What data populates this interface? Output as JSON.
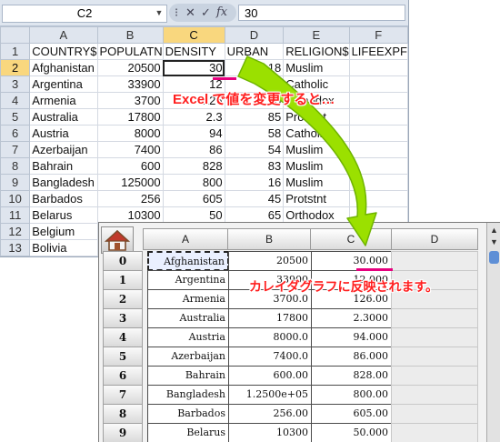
{
  "excel": {
    "name_box": "C2",
    "formula_value": "30",
    "fx_label": "fx",
    "columns": [
      "A",
      "B",
      "C",
      "D",
      "E",
      "F"
    ],
    "rows": [
      {
        "num": "1",
        "cells": [
          "COUNTRY$",
          "POPULATN",
          "DENSITY",
          "URBAN",
          "RELIGION$",
          "LIFEEXPF"
        ]
      },
      {
        "num": "2",
        "cells": [
          "Afghanistan",
          "20500",
          "30",
          "18",
          "Muslim",
          ""
        ]
      },
      {
        "num": "3",
        "cells": [
          "Argentina",
          "33900",
          "12",
          "86",
          "Catholic",
          ""
        ]
      },
      {
        "num": "4",
        "cells": [
          "Armenia",
          "3700",
          "126",
          "68",
          "Orthodox",
          ""
        ]
      },
      {
        "num": "5",
        "cells": [
          "Australia",
          "17800",
          "2.3",
          "85",
          "Protstnt",
          ""
        ]
      },
      {
        "num": "6",
        "cells": [
          "Austria",
          "8000",
          "94",
          "58",
          "Catholic",
          ""
        ]
      },
      {
        "num": "7",
        "cells": [
          "Azerbaijan",
          "7400",
          "86",
          "54",
          "Muslim",
          ""
        ]
      },
      {
        "num": "8",
        "cells": [
          "Bahrain",
          "600",
          "828",
          "83",
          "Muslim",
          ""
        ]
      },
      {
        "num": "9",
        "cells": [
          "Bangladesh",
          "125000",
          "800",
          "16",
          "Muslim",
          ""
        ]
      },
      {
        "num": "10",
        "cells": [
          "Barbados",
          "256",
          "605",
          "45",
          "Protstnt",
          ""
        ]
      },
      {
        "num": "11",
        "cells": [
          "Belarus",
          "10300",
          "50",
          "65",
          "Orthodox",
          ""
        ]
      },
      {
        "num": "12",
        "cells": [
          "Belgium",
          "",
          "",
          "",
          "",
          ""
        ]
      },
      {
        "num": "13",
        "cells": [
          "Bolivia",
          "",
          "",
          "",
          "",
          ""
        ]
      }
    ]
  },
  "annotations": {
    "excel_note": "Excel で値を変更すると…",
    "kaleida_note": "カレイダグラフに反映されます。"
  },
  "kaleida": {
    "columns": [
      "A",
      "B",
      "C",
      "D"
    ],
    "rows": [
      {
        "num": "0",
        "a": "Afghanistan",
        "b": "20500",
        "c": "30.000"
      },
      {
        "num": "1",
        "a": "Argentina",
        "b": "33900",
        "c": "12.000"
      },
      {
        "num": "2",
        "a": "Armenia",
        "b": "3700.0",
        "c": "126.00"
      },
      {
        "num": "3",
        "a": "Australia",
        "b": "17800",
        "c": "2.3000"
      },
      {
        "num": "4",
        "a": "Austria",
        "b": "8000.0",
        "c": "94.000"
      },
      {
        "num": "5",
        "a": "Azerbaijan",
        "b": "7400.0",
        "c": "86.000"
      },
      {
        "num": "6",
        "a": "Bahrain",
        "b": "600.00",
        "c": "828.00"
      },
      {
        "num": "7",
        "a": "Bangladesh",
        "b": "1.2500e+05",
        "c": "800.00"
      },
      {
        "num": "8",
        "a": "Barbados",
        "b": "256.00",
        "c": "605.00"
      },
      {
        "num": "9",
        "a": "Belarus",
        "b": "10300",
        "c": "50.000"
      }
    ]
  },
  "colors": {
    "annotation_red": "#ff1e1e",
    "underline_magenta": "#e6007e",
    "arrow_green": "#9be000",
    "selected_header": "#f9d77e"
  },
  "icons": {
    "home": "home-icon",
    "arrow": "curved-arrow-icon"
  }
}
